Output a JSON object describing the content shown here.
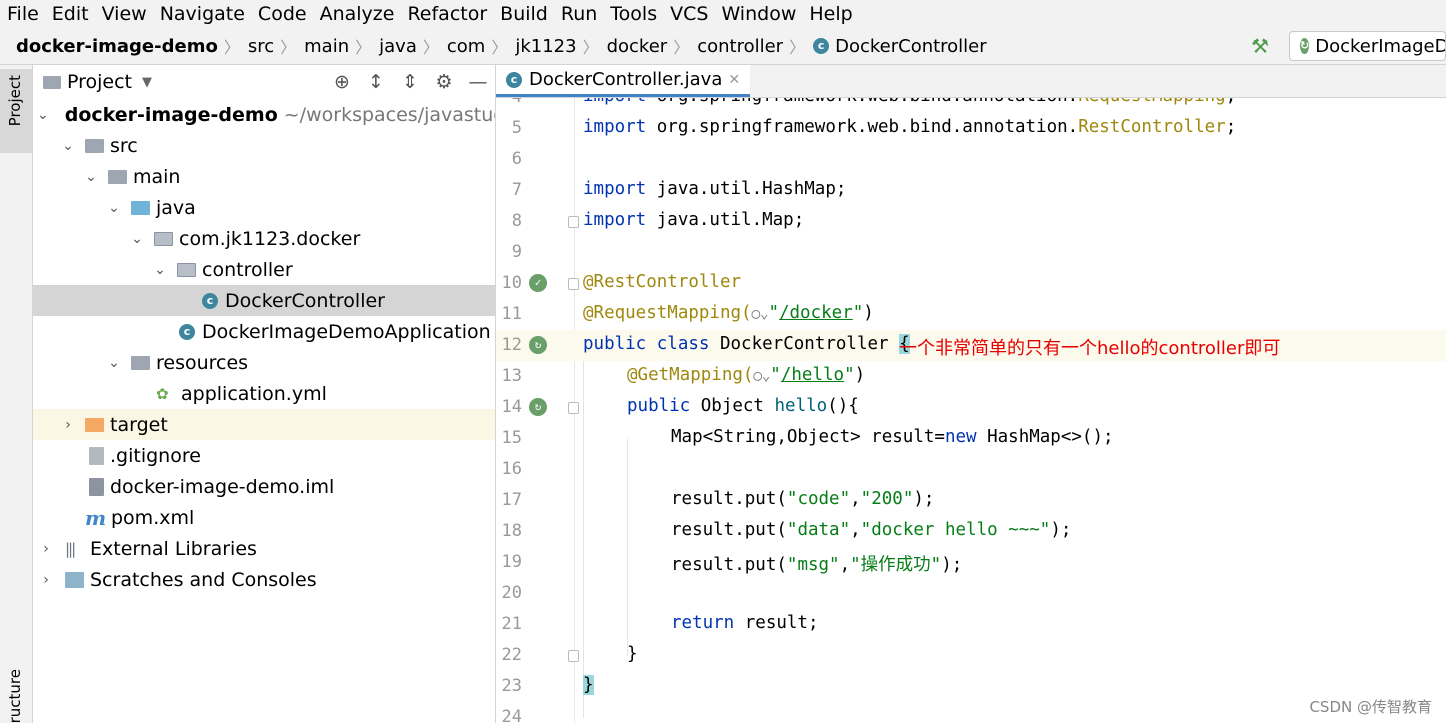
{
  "menu": [
    "File",
    "Edit",
    "View",
    "Navigate",
    "Code",
    "Analyze",
    "Refactor",
    "Build",
    "Run",
    "Tools",
    "VCS",
    "Window",
    "Help"
  ],
  "breadcrumb": [
    "docker-image-demo",
    "src",
    "main",
    "java",
    "com",
    "jk1123",
    "docker",
    "controller",
    "DockerController"
  ],
  "run_config": "DockerImageD",
  "side_tabs": {
    "project": "Project",
    "structure": "ructure"
  },
  "project_panel": {
    "title": "Project",
    "root_name": "docker-image-demo",
    "root_path": "~/workspaces/javastudy/m",
    "items": {
      "src": "src",
      "main": "main",
      "java": "java",
      "package": "com.jk1123.docker",
      "controller": "controller",
      "docker_controller": "DockerController",
      "app": "DockerImageDemoApplication",
      "resources": "resources",
      "app_yml": "application.yml",
      "target": "target",
      "gitignore": ".gitignore",
      "iml": "docker-image-demo.iml",
      "pom": "pom.xml",
      "ext_libs": "External Libraries",
      "scratches": "Scratches and Consoles"
    }
  },
  "editor": {
    "tab_label": "DockerController.java",
    "line_numbers": [
      "4",
      "5",
      "6",
      "7",
      "8",
      "9",
      "10",
      "11",
      "12",
      "13",
      "14",
      "15",
      "16",
      "17",
      "18",
      "19",
      "20",
      "21",
      "22",
      "23",
      "24"
    ],
    "code": {
      "l4_kw": "import",
      "l4_pkg": " org.springframework.web.bind.annotation.",
      "l4_cls": "RequestMapping",
      "l4_end": ";",
      "l5_kw": "import",
      "l5_pkg": " org.springframework.web.bind.annotation.",
      "l5_cls": "RestController",
      "l5_end": ";",
      "l7_kw": "import",
      "l7_rest": " java.util.HashMap;",
      "l8_kw": "import",
      "l8_rest": " java.util.Map;",
      "l10_ann": "@RestController",
      "l11_ann": "@RequestMapping(",
      "l11_q1": "\"",
      "l11_path": "/docker",
      "l11_q2": "\"",
      "l11_end": ")",
      "l12_kw": "public class",
      "l12_name": " DockerController ",
      "l12_brace": "{",
      "l13_ann": "@GetMapping(",
      "l13_q1": "\"",
      "l13_path": "/hello",
      "l13_q2": "\"",
      "l13_end": ")",
      "l14_kw": "public",
      "l14_type": " Object ",
      "l14_fn": "hello",
      "l14_end": "(){",
      "l15_a": "Map<String,Object> result=",
      "l15_kw": "new",
      "l15_b": " HashMap<>();",
      "l17_a": "result.put(",
      "l17_s1": "\"code\"",
      "l17_c": ",",
      "l17_s2": "\"200\"",
      "l17_end": ");",
      "l18_a": "result.put(",
      "l18_s1": "\"data\"",
      "l18_c": ",",
      "l18_s2": "\"docker hello ~~~\"",
      "l18_end": ");",
      "l19_a": "result.put(",
      "l19_s1": "\"msg\"",
      "l19_c": ",",
      "l19_s2": "\"操作成功\"",
      "l19_end": ");",
      "l21_kw": "return",
      "l21_rest": " result;",
      "l22": "}",
      "l23": "}"
    },
    "annotation_note": "一个非常简单的只有一个hello的controller即可"
  },
  "watermark": "CSDN @传智教育",
  "colors": {
    "keyword": "#0033b3",
    "annotation": "#9e880d",
    "string": "#067d17",
    "note": "#e60000"
  }
}
